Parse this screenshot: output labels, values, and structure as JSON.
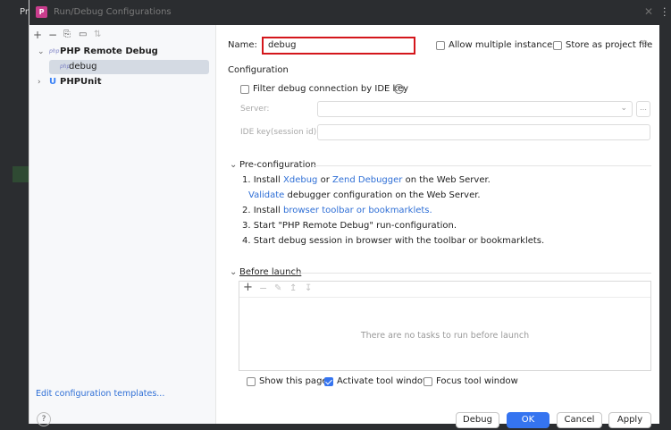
{
  "ide": {
    "left_label": "Pr"
  },
  "dialog": {
    "title": "Run/Debug Configurations"
  },
  "tree": {
    "toolbar": [
      "+",
      "−",
      "⎘",
      "▭",
      "⇅"
    ],
    "items": [
      {
        "label": "PHP Remote Debug",
        "icon": "php-icon",
        "expanded": true
      },
      {
        "label": "debug",
        "icon": "php-icon",
        "selected": true
      },
      {
        "label": "PHPUnit",
        "icon": "phpunit-icon",
        "expanded": false
      }
    ],
    "edit_templates": "Edit configuration templates...",
    "help": "?"
  },
  "form": {
    "name_label": "Name:",
    "name_value": "debug",
    "allow_multiple": "Allow multiple instances",
    "store_as_project": "Store as project file",
    "configuration_title": "Configuration",
    "filter_label": "Filter debug connection by IDE key",
    "server_label": "Server:",
    "ide_key_label": "IDE key(session id):",
    "preconfig_title": "Pre-configuration",
    "steps": {
      "s1_prefix": "1. Install",
      "s1_xdebug": "Xdebug",
      "s1_or": "or",
      "s1_zend": "Zend Debugger",
      "s1_suffix": "on the Web Server.",
      "s1b_validate": "Validate",
      "s1b_suffix": "debugger configuration on the Web Server.",
      "s2_prefix": "2. Install",
      "s2_link": "browser toolbar or bookmarklets.",
      "s3": "3. Start \"PHP Remote Debug\" run-configuration.",
      "s4": "4. Start debug session in browser with the toolbar or bookmarklets."
    },
    "before_launch_title": "Before launch",
    "tasks_empty": "There are no tasks to run before launch",
    "show_page": "Show this page",
    "activate_tool": "Activate tool window",
    "focus_tool": "Focus tool window"
  },
  "buttons": {
    "debug": "Debug",
    "ok": "OK",
    "cancel": "Cancel",
    "apply": "Apply"
  },
  "colors": {
    "accent": "#3574f0",
    "name_highlight": "#d4161b",
    "link": "#2f6fd6"
  }
}
